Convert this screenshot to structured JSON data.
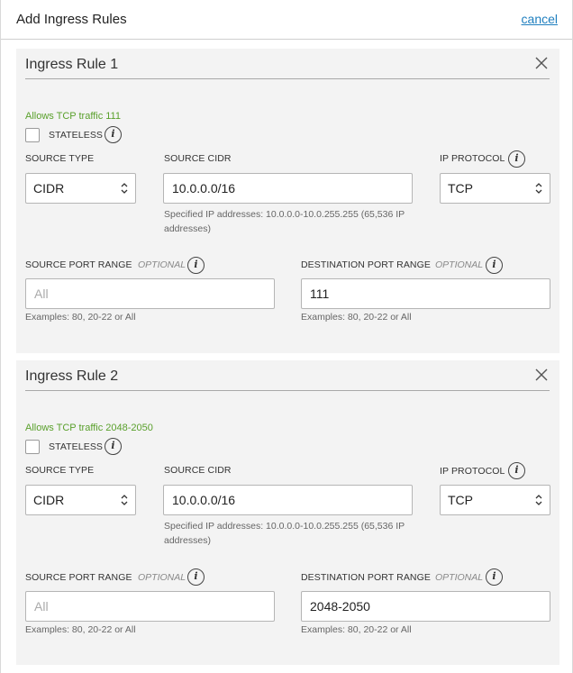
{
  "dialog": {
    "title": "Add Ingress Rules",
    "cancel_label": "cancel"
  },
  "rules": [
    {
      "title": "Ingress Rule 1",
      "description": "Allows TCP traffic 111",
      "stateless_label": "STATELESS",
      "source_type_label": "SOURCE TYPE",
      "source_type_value": "CIDR",
      "source_cidr_label": "SOURCE CIDR",
      "source_cidr_value": "10.0.0.0/16",
      "source_cidr_help": "Specified IP addresses: 10.0.0.0-10.0.255.255 (65,536 IP addresses)",
      "ip_protocol_label": "IP PROTOCOL",
      "ip_protocol_value": "TCP",
      "source_port_label": "SOURCE PORT RANGE",
      "source_port_optional": "OPTIONAL",
      "source_port_placeholder": "All",
      "source_port_value": "",
      "source_port_help": "Examples: 80, 20-22 or All",
      "dest_port_label": "DESTINATION PORT RANGE",
      "dest_port_optional": "OPTIONAL",
      "dest_port_value": "111",
      "dest_port_help": "Examples: 80, 20-22 or All"
    },
    {
      "title": "Ingress Rule 2",
      "description": "Allows TCP traffic 2048-2050",
      "stateless_label": "STATELESS",
      "source_type_label": "SOURCE TYPE",
      "source_type_value": "CIDR",
      "source_cidr_label": "SOURCE CIDR",
      "source_cidr_value": "10.0.0.0/16",
      "source_cidr_help": "Specified IP addresses: 10.0.0.0-10.0.255.255 (65,536 IP addresses)",
      "ip_protocol_label": "IP PROTOCOL",
      "ip_protocol_value": "TCP",
      "source_port_label": "SOURCE PORT RANGE",
      "source_port_optional": "OPTIONAL",
      "source_port_placeholder": "All",
      "source_port_value": "",
      "source_port_help": "Examples: 80, 20-22 or All",
      "dest_port_label": "DESTINATION PORT RANGE",
      "dest_port_optional": "OPTIONAL",
      "dest_port_value": "2048-2050",
      "dest_port_help": "Examples: 80, 20-22 or All"
    }
  ],
  "icons": {
    "info_glyph": "i",
    "close": "close-icon",
    "info": "info-icon",
    "select_arrows": "select-arrows-icon"
  },
  "colors": {
    "accent_link": "#1f7fbf",
    "description_green": "#5aa02c",
    "panel_bg": "#f3f3f3"
  }
}
